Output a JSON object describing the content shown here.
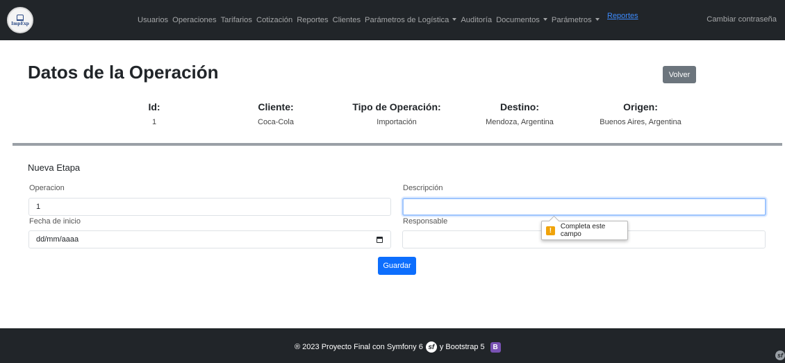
{
  "navbar": {
    "logo_text": "ImpExp",
    "items": [
      {
        "label": "Usuarios",
        "dropdown": false
      },
      {
        "label": "Operaciones",
        "dropdown": false
      },
      {
        "label": "Tarifarios",
        "dropdown": false
      },
      {
        "label": "Cotización",
        "dropdown": false
      },
      {
        "label": "Reportes",
        "dropdown": false
      },
      {
        "label": "Clientes",
        "dropdown": false
      },
      {
        "label": "Parámetros de Logística",
        "dropdown": true
      },
      {
        "label": "Auditoría",
        "dropdown": false
      },
      {
        "label": "Documentos",
        "dropdown": true
      },
      {
        "label": "Parámetros",
        "dropdown": true
      }
    ],
    "extra_link": "Reportes",
    "right_link": "Cambiar contraseña"
  },
  "page": {
    "title": "Datos de la Operación",
    "back_button": "Volver"
  },
  "operation": {
    "headers": [
      "Id:",
      "Cliente:",
      "Tipo de Operación:",
      "Destino:",
      "Origen:"
    ],
    "values": [
      "1",
      "Coca-Cola",
      "Importación",
      "Mendoza, Argentina",
      "Buenos Aires, Argentina"
    ]
  },
  "form": {
    "section_title": "Nueva Etapa",
    "operacion_label": "Operacion",
    "operacion_value": "1",
    "descripcion_label": "Descripción",
    "descripcion_value": "",
    "fecha_label": "Fecha de inicio",
    "fecha_placeholder": "dd/mm/aaaa",
    "responsable_label": "Responsable",
    "responsable_value": "",
    "validation_message": "Completa este campo",
    "save_button": "Guardar"
  },
  "footer": {
    "text_before": "® 2023 Proyecto Final con Symfony 6",
    "text_middle": "y Bootstrap 5",
    "symfony_glyph": "sf",
    "bootstrap_glyph": "B"
  },
  "colors": {
    "navbar_bg": "#212529",
    "primary": "#0d6efd",
    "secondary": "#6c757d",
    "warning": "#f0a30a",
    "bootstrap_purple": "#7952b3"
  }
}
